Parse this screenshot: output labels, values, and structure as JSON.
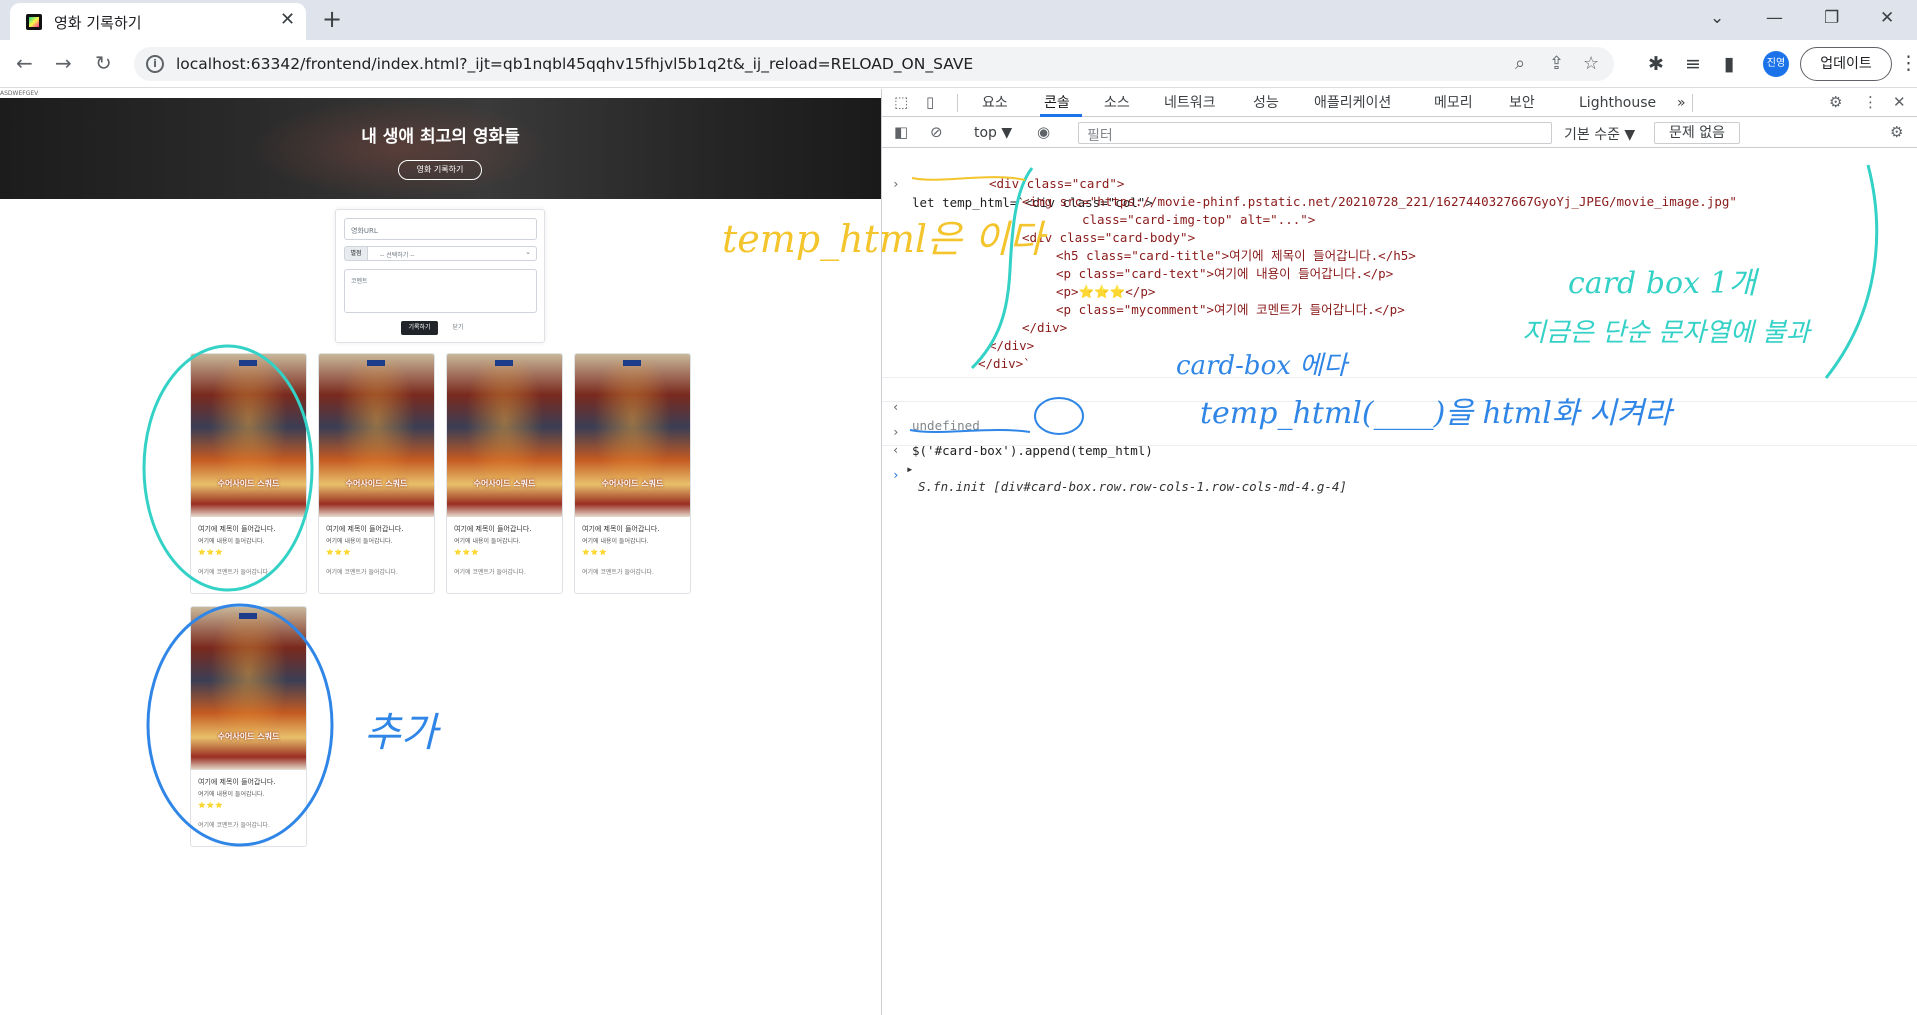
{
  "browser": {
    "tab_title": "영화 기록하기",
    "tab_close": "✕",
    "new_tab": "+",
    "url": "localhost:63342/frontend/index.html?_ijt=qb1nqbl45qqhv15fhjvl5b1q2t&_ij_reload=RELOAD_ON_SAVE",
    "profile_label": "진영",
    "update_label": "업데이트"
  },
  "page": {
    "tiny_text": "ASDWEFGEV",
    "hero_title": "내 생애 최고의 영화들",
    "hero_button": "영화 기록하기",
    "form": {
      "url_placeholder": "영화URL",
      "rating_label": "별점",
      "rating_select": "-- 선택하기 --",
      "comment_placeholder": "코멘트",
      "submit_label": "기록하기",
      "close_label": "닫기"
    },
    "cards": [
      {
        "poster_title": "수어사이드 스쿼드",
        "title": "여기에 제목이 들어갑니다.",
        "text": "여기에 내용이 들어갑니다.",
        "stars": "⭐⭐⭐",
        "comment": "여기에 코멘트가 들어갑니다."
      },
      {
        "poster_title": "수어사이드 스쿼드",
        "title": "여기에 제목이 들어갑니다.",
        "text": "여기에 내용이 들어갑니다.",
        "stars": "⭐⭐⭐",
        "comment": "여기에 코멘트가 들어갑니다."
      },
      {
        "poster_title": "수어사이드 스쿼드",
        "title": "여기에 제목이 들어갑니다.",
        "text": "여기에 내용이 들어갑니다.",
        "stars": "⭐⭐⭐",
        "comment": "여기에 코멘트가 들어갑니다."
      },
      {
        "poster_title": "수어사이드 스쿼드",
        "title": "여기에 제목이 들어갑니다.",
        "text": "여기에 내용이 들어갑니다.",
        "stars": "⭐⭐⭐",
        "comment": "여기에 코멘트가 들어갑니다."
      },
      {
        "poster_title": "수어사이드 스쿼드",
        "title": "여기에 제목이 들어갑니다.",
        "text": "여기에 내용이 들어갑니다.",
        "stars": "⭐⭐⭐",
        "comment": "여기에 코멘트가 들어갑니다."
      }
    ]
  },
  "devtools": {
    "tabs": [
      "요소",
      "콘솔",
      "소스",
      "네트워크",
      "성능",
      "애플리케이션",
      "메모리",
      "보안",
      "Lighthouse"
    ],
    "active_tab": "콘솔",
    "more_tabs": "»",
    "context": "top ▼",
    "filter_placeholder": "필터",
    "levels": "기본 수준 ▼",
    "issues": "문제 없음",
    "console_lines": [
      "let temp_html=`<div class=\"col\">",
      "<div class=\"card\">",
      "<img src=\"https://movie-phinf.pstatic.net/20210728_221/1627440327667GyoYj_JPEG/movie_image.jpg\"",
      "class=\"card-img-top\" alt=\"...\">",
      "<div class=\"card-body\">",
      "<h5 class=\"card-title\">여기에 제목이 들어갑니다.</h5>",
      "<p class=\"card-text\">여기에 내용이 들어갑니다.</p>",
      "<p>⭐⭐⭐</p>",
      "<p class=\"mycomment\">여기에 코멘트가 들어갑니다.</p>",
      "</div>",
      "</div>",
      "</div>`"
    ],
    "undefined_text": "undefined",
    "append_cmd": "$('#card-box').append(temp_html)",
    "append_result": "S.fn.init [div#card-box.row.row-cols-1.row-cols-md-4.g-4]"
  },
  "annotations": {
    "temp_html_is": "temp_html은   이다",
    "card_box_1": "card box 1개",
    "just_string": "지금은 단순 문자열에 불과",
    "card_box_to": "card-box 에다",
    "make_html": "temp_html(____)을 html화 시켜라",
    "added": "추가"
  },
  "colors": {
    "accent_blue": "#1a73e8",
    "annotation_yellow": "#f3c42b",
    "annotation_teal": "#33d1c6",
    "annotation_blue": "#2f86e6"
  }
}
